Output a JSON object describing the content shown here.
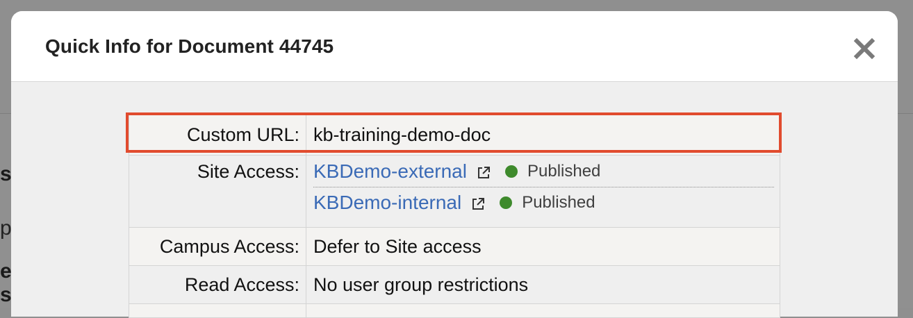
{
  "modal": {
    "title": "Quick Info for Document 44745",
    "close_icon": "close-x-icon"
  },
  "background_chars": [
    "s",
    "p",
    "e.",
    "s"
  ],
  "fields": {
    "custom_url": {
      "label": "Custom URL:",
      "value": "kb-training-demo-doc"
    },
    "site_access": {
      "label": "Site Access:",
      "sites": [
        {
          "name": "KBDemo-external",
          "icon": "external-link-icon",
          "status": "Published",
          "status_color": "#3e8a2c"
        },
        {
          "name": "KBDemo-internal",
          "icon": "external-link-icon",
          "status": "Published",
          "status_color": "#3e8a2c"
        }
      ]
    },
    "campus_access": {
      "label": "Campus Access:",
      "value": "Defer to Site access"
    },
    "read_access": {
      "label": "Read Access:",
      "value": "No user group restrictions"
    }
  },
  "colors": {
    "link": "#3a6ab6",
    "highlight": "#e14b2e",
    "status_published": "#3e8a2c"
  }
}
